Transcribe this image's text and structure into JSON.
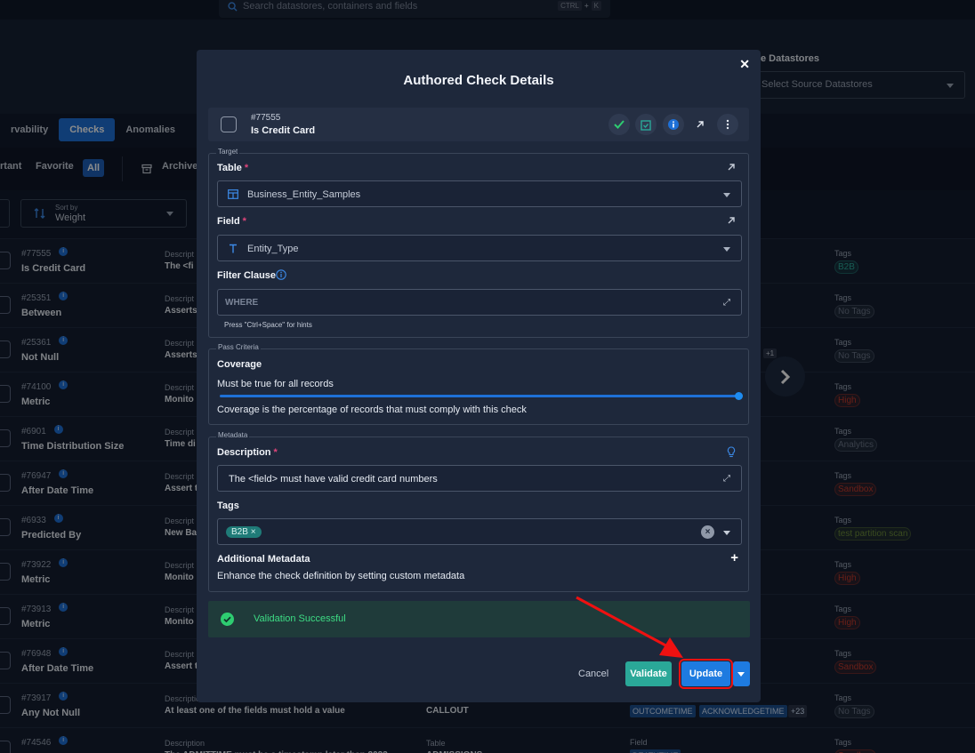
{
  "search": {
    "placeholder": "Search datastores, containers and fields",
    "kbd1": "CTRL",
    "kbd_plus": "+",
    "kbd2": "K"
  },
  "source": {
    "label": "e Datastores",
    "placeholder": "Select Source Datastores"
  },
  "tabs": [
    {
      "label": "rvability"
    },
    {
      "label": "Checks"
    },
    {
      "label": "Anomalies"
    }
  ],
  "filters": {
    "important": "rtant",
    "favorite": "Favorite",
    "all": "All",
    "archived": "Archive"
  },
  "sort": {
    "label": "Sort by",
    "value": "Weight"
  },
  "rows": [
    {
      "id": "#77555",
      "name": "Is Credit Card",
      "desc_label": "Descript",
      "desc": "The <fi",
      "tags_label": "Tags",
      "tag": "B2B",
      "tag_color": "#2aa898"
    },
    {
      "id": "#25351",
      "name": "Between",
      "desc_label": "Descript",
      "desc": "Asserts",
      "tags_label": "Tags",
      "tag": "No Tags",
      "tag_color": "#6b7588"
    },
    {
      "id": "#25361",
      "name": "Not Null",
      "desc_label": "Descript",
      "desc": "Asserts",
      "tags_label": "Tags",
      "tag": "No Tags",
      "tag_color": "#6b7588"
    },
    {
      "id": "#74100",
      "name": "Metric",
      "desc_label": "Descript",
      "desc": "Monito",
      "tags_label": "Tags",
      "tag": "High",
      "tag_color": "#c0392b"
    },
    {
      "id": "#6901",
      "name": "Time Distribution Size",
      "desc_label": "Descript",
      "desc": "Time di",
      "tags_label": "Tags",
      "tag": "Analytics",
      "tag_color": "#6b7588"
    },
    {
      "id": "#76947",
      "name": "After Date Time",
      "desc_label": "Descript",
      "desc": "Assert t",
      "tags_label": "Tags",
      "tag": "Sandbox",
      "tag_color": "#c0392b"
    },
    {
      "id": "#6933",
      "name": "Predicted By",
      "desc_label": "Descript",
      "desc": "New Ba",
      "tags_label": "Tags",
      "tag": "test partition scan",
      "tag_color": "#6b8a3a"
    },
    {
      "id": "#73922",
      "name": "Metric",
      "desc_label": "Descript",
      "desc": "Monito",
      "tags_label": "Tags",
      "tag": "High",
      "tag_color": "#c0392b"
    },
    {
      "id": "#73913",
      "name": "Metric",
      "desc_label": "Descript",
      "desc": "Monito",
      "tags_label": "Tags",
      "tag": "High",
      "tag_color": "#c0392b"
    },
    {
      "id": "#76948",
      "name": "After Date Time",
      "desc_label": "Descript",
      "desc": "Assert t",
      "tags_label": "Tags",
      "tag": "Sandbox",
      "tag_color": "#c0392b"
    },
    {
      "id": "#73917",
      "name": "Any Not Null",
      "desc_label": "Description",
      "desc": "At least one of the fields must hold a value",
      "table_label": "",
      "table": "CALLOUT",
      "field_label": "",
      "fields": [
        "OUTCOMETIME",
        "ACKNOWLEDGETIME",
        "+23"
      ],
      "tags_label": "Tags",
      "tag": "No Tags",
      "tag_color": "#6b7588"
    },
    {
      "id": "#74546",
      "name": "After Date Time",
      "desc_label": "Description",
      "desc": "The ADMITTIME must be a timestamp later than 2033-",
      "table_label": "Table",
      "table": "ADMISSIONS",
      "field_label": "Field",
      "fields": [
        "DEATHTIME"
      ],
      "tags_label": "Tags",
      "tag": "Sandbox",
      "tag_color": "#c0392b"
    }
  ],
  "plus_one": "+1",
  "modal": {
    "title": "Authored Check Details",
    "check_id": "#77555",
    "check_name": "Is Credit Card",
    "target_legend": "Target",
    "table_label": "Table",
    "table_value": "Business_Entity_Samples",
    "field_label": "Field",
    "field_value": "Entity_Type",
    "filter_label": "Filter Clause",
    "filter_placeholder": "WHERE",
    "filter_hint": "Press \"Ctrl+Space\" for hints",
    "pass_legend": "Pass Criteria",
    "coverage_label": "Coverage",
    "coverage_text": "Must be true for all records",
    "coverage_value": 1.0,
    "coverage_help": "Coverage is the percentage of records that must comply with this check",
    "meta_legend": "Metadata",
    "desc_label": "Description",
    "desc_value": "The <field> must have valid credit card numbers",
    "tags_label": "Tags",
    "tag_chip": "B2B",
    "addl_label": "Additional Metadata",
    "addl_help": "Enhance the check definition by setting custom metadata",
    "validation": "Validation Successful",
    "cancel": "Cancel",
    "validate": "Validate",
    "update": "Update"
  },
  "colors": {
    "accent": "#1e70d6",
    "success": "#3ddc84",
    "required": "#e0457b",
    "highlight": "#e11111"
  }
}
